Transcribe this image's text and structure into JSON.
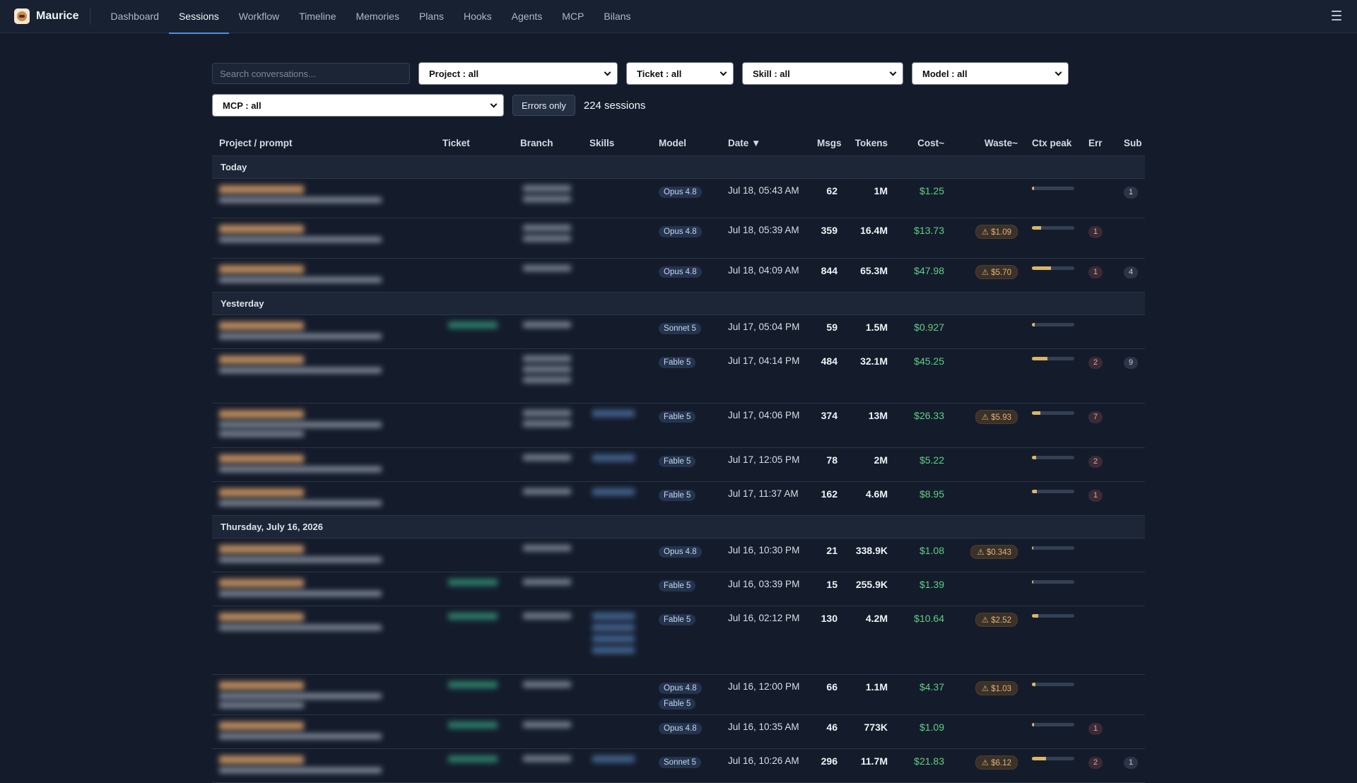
{
  "app": {
    "name": "Maurice"
  },
  "nav": [
    {
      "label": "Dashboard",
      "active": false
    },
    {
      "label": "Sessions",
      "active": true
    },
    {
      "label": "Workflow",
      "active": false
    },
    {
      "label": "Timeline",
      "active": false
    },
    {
      "label": "Memories",
      "active": false
    },
    {
      "label": "Plans",
      "active": false
    },
    {
      "label": "Hooks",
      "active": false
    },
    {
      "label": "Agents",
      "active": false
    },
    {
      "label": "MCP",
      "active": false
    },
    {
      "label": "Bilans",
      "active": false
    }
  ],
  "filters": {
    "search_placeholder": "Search conversations...",
    "project": "Project : all",
    "ticket": "Ticket : all",
    "skill": "Skill : all",
    "model": "Model : all",
    "mcp": "MCP : all",
    "errors_only": "Errors only",
    "session_count": "224 sessions"
  },
  "columns": [
    "Project / prompt",
    "Ticket",
    "Branch",
    "Skills",
    "Model",
    "Date ▼",
    "Msgs",
    "Tokens",
    "Cost~",
    "Waste~",
    "Ctx peak",
    "Err",
    "Sub"
  ],
  "groups": [
    {
      "label": "Today",
      "rows": [
        {
          "has_ticket": false,
          "branch_lines": 2,
          "skill_lines": 0,
          "sub_lines": 1,
          "models": [
            "Opus 4.8"
          ],
          "date": "Jul 18, 05:43 AM",
          "msgs": "62",
          "tokens": "1M",
          "cost": "$1.25",
          "waste": "",
          "ctx": 0.05,
          "err": "",
          "sub": "1",
          "height": 56
        },
        {
          "has_ticket": false,
          "branch_lines": 2,
          "skill_lines": 0,
          "sub_lines": 1,
          "models": [
            "Opus 4.8"
          ],
          "date": "Jul 18, 05:39 AM",
          "msgs": "359",
          "tokens": "16.4M",
          "cost": "$13.73",
          "waste": "⚠ $1.09",
          "ctx": 0.22,
          "err": "1",
          "sub": "",
          "height": 57
        },
        {
          "has_ticket": false,
          "branch_lines": 1,
          "skill_lines": 0,
          "sub_lines": 1,
          "models": [
            "Opus 4.8"
          ],
          "date": "Jul 18, 04:09 AM",
          "msgs": "844",
          "tokens": "65.3M",
          "cost": "$47.98",
          "waste": "⚠ $5.70",
          "ctx": 0.45,
          "err": "1",
          "sub": "4",
          "height": 48
        }
      ]
    },
    {
      "label": "Yesterday",
      "rows": [
        {
          "has_ticket": true,
          "branch_lines": 1,
          "skill_lines": 0,
          "sub_lines": 1,
          "models": [
            "Sonnet 5"
          ],
          "date": "Jul 17, 05:04 PM",
          "msgs": "59",
          "tokens": "1.5M",
          "cost": "$0.927",
          "waste": "",
          "ctx": 0.06,
          "err": "",
          "sub": "",
          "height": 48
        },
        {
          "has_ticket": false,
          "branch_lines": 3,
          "skill_lines": 0,
          "sub_lines": 1,
          "models": [
            "Fable 5"
          ],
          "date": "Jul 17, 04:14 PM",
          "msgs": "484",
          "tokens": "32.1M",
          "cost": "$45.25",
          "waste": "",
          "ctx": 0.37,
          "err": "2",
          "sub": "9",
          "height": 77
        },
        {
          "has_ticket": false,
          "branch_lines": 2,
          "skill_lines": 1,
          "sub_lines": 2,
          "models": [
            "Fable 5"
          ],
          "date": "Jul 17, 04:06 PM",
          "msgs": "374",
          "tokens": "13M",
          "cost": "$26.33",
          "waste": "⚠ $5.93",
          "ctx": 0.2,
          "err": "7",
          "sub": "",
          "height": 63
        },
        {
          "has_ticket": false,
          "branch_lines": 1,
          "skill_lines": 1,
          "sub_lines": 1,
          "models": [
            "Fable 5"
          ],
          "date": "Jul 17, 12:05 PM",
          "msgs": "78",
          "tokens": "2M",
          "cost": "$5.22",
          "waste": "",
          "ctx": 0.1,
          "err": "2",
          "sub": "",
          "height": 48
        },
        {
          "has_ticket": false,
          "branch_lines": 1,
          "skill_lines": 1,
          "sub_lines": 1,
          "models": [
            "Fable 5"
          ],
          "date": "Jul 17, 11:37 AM",
          "msgs": "162",
          "tokens": "4.6M",
          "cost": "$8.95",
          "waste": "",
          "ctx": 0.12,
          "err": "1",
          "sub": "",
          "height": 48
        }
      ]
    },
    {
      "label": "Thursday, July 16, 2026",
      "rows": [
        {
          "has_ticket": false,
          "branch_lines": 1,
          "skill_lines": 0,
          "sub_lines": 1,
          "models": [
            "Opus 4.8"
          ],
          "date": "Jul 16, 10:30 PM",
          "msgs": "21",
          "tokens": "338.9K",
          "cost": "$1.08",
          "waste": "⚠ $0.343",
          "ctx": 0.04,
          "err": "",
          "sub": "",
          "height": 48
        },
        {
          "has_ticket": true,
          "branch_lines": 1,
          "skill_lines": 0,
          "sub_lines": 1,
          "models": [
            "Fable 5"
          ],
          "date": "Jul 16, 03:39 PM",
          "msgs": "15",
          "tokens": "255.9K",
          "cost": "$1.39",
          "waste": "",
          "ctx": 0.04,
          "err": "",
          "sub": "",
          "height": 48
        },
        {
          "has_ticket": true,
          "branch_lines": 1,
          "skill_lines": 4,
          "sub_lines": 1,
          "models": [
            "Fable 5"
          ],
          "date": "Jul 16, 02:12 PM",
          "msgs": "130",
          "tokens": "4.2M",
          "cost": "$10.64",
          "waste": "⚠ $2.52",
          "ctx": 0.15,
          "err": "",
          "sub": "",
          "height": 97
        },
        {
          "has_ticket": true,
          "branch_lines": 1,
          "skill_lines": 0,
          "sub_lines": 2,
          "models": [
            "Opus 4.8",
            "Fable 5"
          ],
          "date": "Jul 16, 12:00 PM",
          "msgs": "66",
          "tokens": "1.1M",
          "cost": "$4.37",
          "waste": "⚠ $1.03",
          "ctx": 0.09,
          "err": "",
          "sub": "",
          "height": 57
        },
        {
          "has_ticket": true,
          "branch_lines": 1,
          "skill_lines": 0,
          "sub_lines": 1,
          "models": [
            "Opus 4.8"
          ],
          "date": "Jul 16, 10:35 AM",
          "msgs": "46",
          "tokens": "773K",
          "cost": "$1.09",
          "waste": "",
          "ctx": 0.05,
          "err": "1",
          "sub": "",
          "height": 48
        },
        {
          "has_ticket": true,
          "branch_lines": 1,
          "skill_lines": 1,
          "sub_lines": 1,
          "models": [
            "Sonnet 5"
          ],
          "date": "Jul 16, 10:26 AM",
          "msgs": "296",
          "tokens": "11.7M",
          "cost": "$21.83",
          "waste": "⚠ $6.12",
          "ctx": 0.33,
          "err": "2",
          "sub": "1",
          "height": 48
        }
      ]
    }
  ]
}
